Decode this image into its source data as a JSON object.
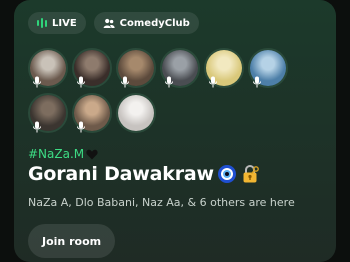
{
  "room": {
    "live_label": "LIVE",
    "club_label": "ComedyClub",
    "tag": "#NaZa.M",
    "title": "Gorani Dawakraw",
    "participants_text": "NaZa A, Dlo Babani, Naz Aa, & 6 others are here",
    "join_label": "Join room"
  },
  "avatars": [
    {
      "name": "avatar-1",
      "colors": [
        "#6b5a4e",
        "#c9c2b8"
      ]
    },
    {
      "name": "avatar-2",
      "colors": [
        "#3a2e2a",
        "#8e7b6d"
      ]
    },
    {
      "name": "avatar-3",
      "colors": [
        "#5c4a3c",
        "#a6896c"
      ]
    },
    {
      "name": "avatar-4",
      "colors": [
        "#4a4d52",
        "#9aa0a6"
      ]
    },
    {
      "name": "avatar-5",
      "colors": [
        "#d9c87a",
        "#f2e9c0"
      ]
    },
    {
      "name": "avatar-6",
      "colors": [
        "#4d7fa8",
        "#b5d2e6"
      ]
    },
    {
      "name": "avatar-7",
      "colors": [
        "#3b3530",
        "#7d6d5f"
      ]
    },
    {
      "name": "avatar-8",
      "colors": [
        "#6e5a4a",
        "#caa98a"
      ]
    },
    {
      "name": "avatar-9",
      "colors": [
        "#c7c3c0",
        "#f3f1ef"
      ]
    }
  ],
  "colors": {
    "accent": "#3ddc84",
    "live_bars": "#2fd47a"
  },
  "icons": [
    "live-bars-icon",
    "people-icon",
    "mic-icon",
    "black-heart-icon",
    "nazar-eye-icon",
    "lock-key-icon"
  ]
}
